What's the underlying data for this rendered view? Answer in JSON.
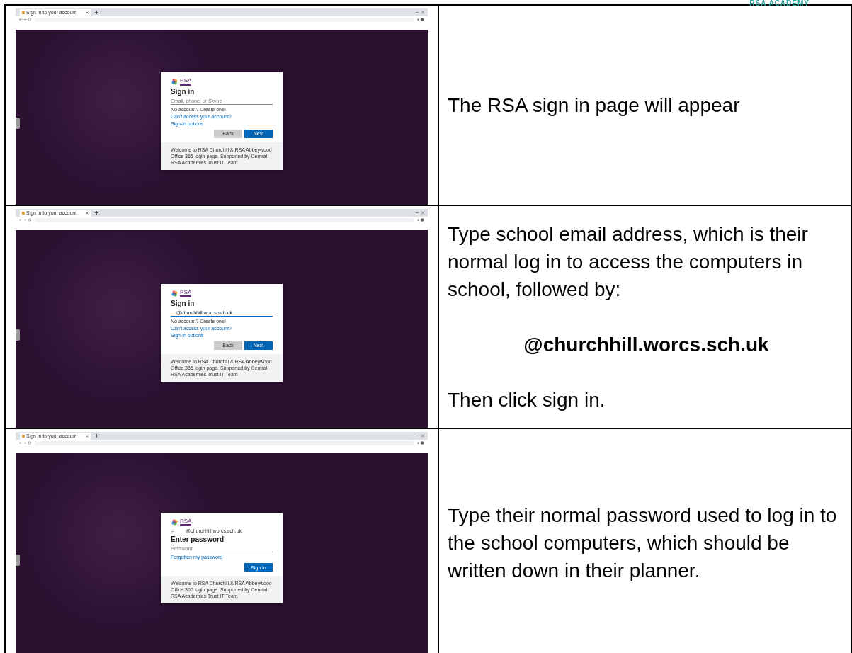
{
  "header": {
    "text": "RSA ACADEMY"
  },
  "steps": [
    {
      "screenshot": {
        "tab_title": "Sign in to your account",
        "card": {
          "logo": "RSA",
          "title": "Sign in",
          "field": {
            "placeholder": "Email, phone, or Skype"
          },
          "links": [
            {
              "text": "No account? Create one!",
              "kind": "plain"
            },
            {
              "text": "Can't access your account?",
              "kind": "link"
            },
            {
              "text": "Sign-in options",
              "kind": "link"
            }
          ],
          "buttons": [
            {
              "label": "Back",
              "kind": "secondary"
            },
            {
              "label": "Next",
              "kind": "primary"
            }
          ],
          "footer": "Welcome to RSA Churchill & RSA Abbeywood Office 365 login page. Supported by Central RSA Academies Trust IT Team"
        }
      },
      "instructions": [
        {
          "text": "The RSA sign in page will appear",
          "kind": "paragraph"
        }
      ]
    },
    {
      "screenshot": {
        "tab_title": "Sign in to your account",
        "card": {
          "logo": "RSA",
          "title": "Sign in",
          "field": {
            "value": "@churchhill.worcs.sch.uk"
          },
          "links": [
            {
              "text": "No account? Create one!",
              "kind": "plain"
            },
            {
              "text": "Can't access your account?",
              "kind": "link"
            },
            {
              "text": "Sign-in options",
              "kind": "link"
            }
          ],
          "buttons": [
            {
              "label": "Back",
              "kind": "secondary"
            },
            {
              "label": "Next",
              "kind": "primary"
            }
          ],
          "footer": "Welcome to RSA Churchill & RSA Abbeywood Office 365 login page. Supported by Central RSA Academies Trust IT Team"
        }
      },
      "instructions": [
        {
          "text": "Type school email address, which is their normal log in to access the computers in school, followed by:",
          "kind": "paragraph"
        },
        {
          "text": "@churchhill.worcs.sch.uk",
          "kind": "emphasis"
        },
        {
          "text": "Then click sign in.",
          "kind": "paragraph"
        }
      ]
    },
    {
      "screenshot": {
        "tab_title": "Sign in to your account",
        "card": {
          "logo": "RSA",
          "identity": {
            "arrow": "←",
            "text": "@churchhill.worcs.sch.uk"
          },
          "title": "Enter password",
          "field": {
            "placeholder": "Password"
          },
          "links": [
            {
              "text": "Forgotten my password",
              "kind": "link"
            }
          ],
          "buttons": [
            {
              "label": "Sign in",
              "kind": "primary"
            }
          ],
          "footer": "Welcome to RSA Churchill & RSA Abbeywood Office 365 login page. Supported by Central RSA Academies Trust IT Team"
        }
      },
      "instructions": [
        {
          "text": "Type their normal password used to log in to the school computers, which should be written down in their planner.",
          "kind": "paragraph"
        }
      ]
    }
  ]
}
